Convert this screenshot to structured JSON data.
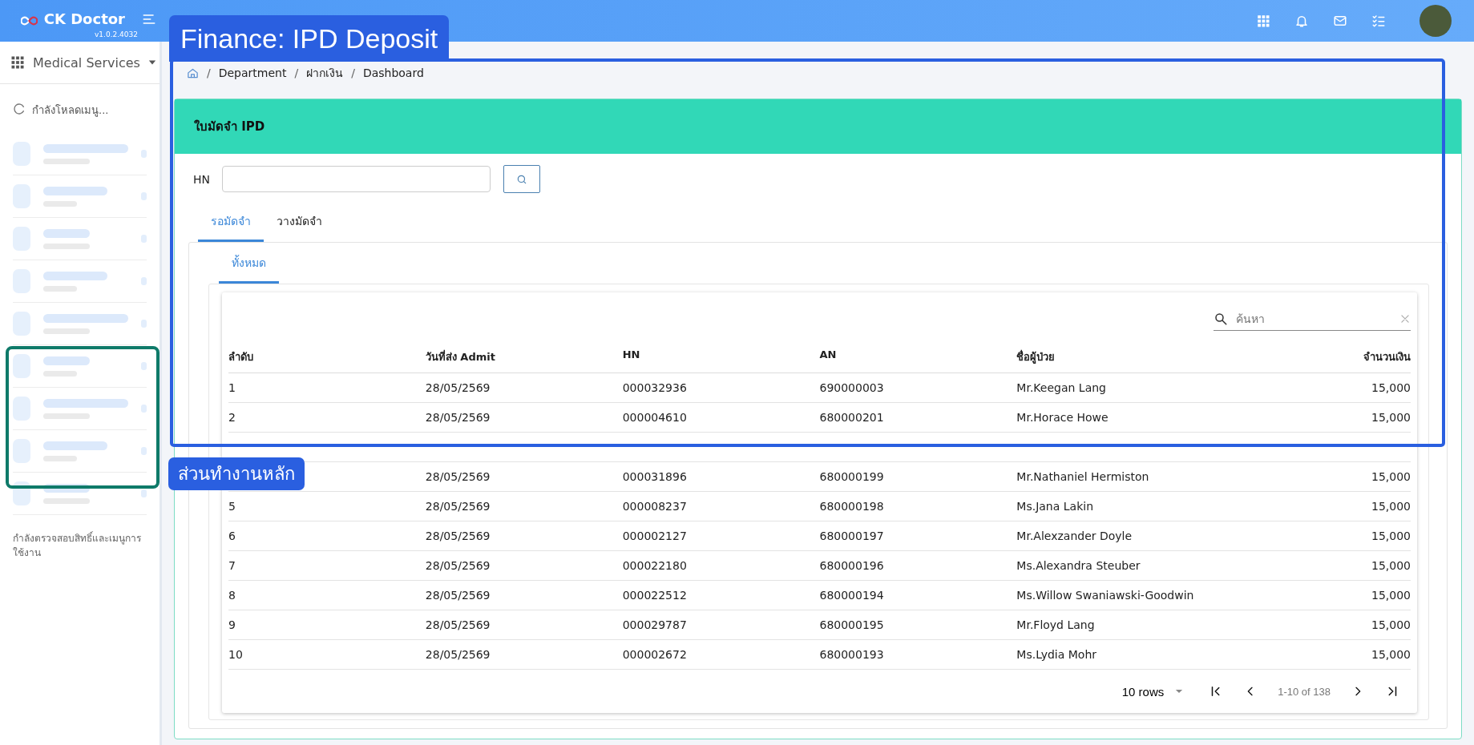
{
  "header": {
    "brand": "CK Doctor",
    "version": "v1.0.2.4032"
  },
  "sidebar": {
    "module": "Medical Services",
    "loading": "กำลังโหลดเมนู...",
    "footer": "กำลังตรวจสอบสิทธิ์และเมนูการใช้งาน"
  },
  "breadcrumb": {
    "separator": "/",
    "items": [
      "Department",
      "ฝากเงิน",
      "Dashboard"
    ]
  },
  "card": {
    "title": "ใบมัดจำ IPD",
    "hn_label": "HN"
  },
  "tabs": [
    {
      "label": "รอมัดจำ",
      "selected": true
    },
    {
      "label": "วางมัดจำ",
      "selected": false
    }
  ],
  "subtabs": [
    {
      "label": "ทั้งหมด",
      "selected": true
    }
  ],
  "table": {
    "search_placeholder": "ค้นหา",
    "columns": [
      "ลำดับ",
      "วันที่ส่ง Admit",
      "HN",
      "AN",
      "ชื่อผู้ป่วย",
      "จำนวนเงิน"
    ],
    "rows": [
      {
        "no": "1",
        "admit_date": "28/05/2569",
        "hn": "000032936",
        "an": "690000003",
        "patient": "Mr.Keegan Lang",
        "amount": "15,000"
      },
      {
        "no": "2",
        "admit_date": "28/05/2569",
        "hn": "000004610",
        "an": "680000201",
        "patient": "Mr.Horace Howe",
        "amount": "15,000"
      },
      {},
      {
        "admit_date": "28/05/2569",
        "hn": "000031896",
        "an": "680000199",
        "patient": "Mr.Nathaniel Hermiston",
        "amount": "15,000"
      },
      {
        "no": "5",
        "admit_date": "28/05/2569",
        "hn": "000008237",
        "an": "680000198",
        "patient": "Ms.Jana Lakin",
        "amount": "15,000"
      },
      {
        "no": "6",
        "admit_date": "28/05/2569",
        "hn": "000002127",
        "an": "680000197",
        "patient": "Mr.Alexzander Doyle",
        "amount": "15,000"
      },
      {
        "no": "7",
        "admit_date": "28/05/2569",
        "hn": "000022180",
        "an": "680000196",
        "patient": "Ms.Alexandra Steuber",
        "amount": "15,000"
      },
      {
        "no": "8",
        "admit_date": "28/05/2569",
        "hn": "000022512",
        "an": "680000194",
        "patient": "Ms.Willow Swaniawski-Goodwin",
        "amount": "15,000"
      },
      {
        "no": "9",
        "admit_date": "28/05/2569",
        "hn": "000029787",
        "an": "680000195",
        "patient": "Mr.Floyd Lang",
        "amount": "15,000"
      },
      {
        "no": "10",
        "admit_date": "28/05/2569",
        "hn": "000002672",
        "an": "680000193",
        "patient": "Ms.Lydia Mohr",
        "amount": "15,000"
      }
    ],
    "rows_per_page": "10 rows",
    "page_info": "1-10 of 138"
  },
  "annotations": {
    "title_label": "Finance: IPD Deposit",
    "region_label": "ส่วนทำงานหลัก"
  }
}
